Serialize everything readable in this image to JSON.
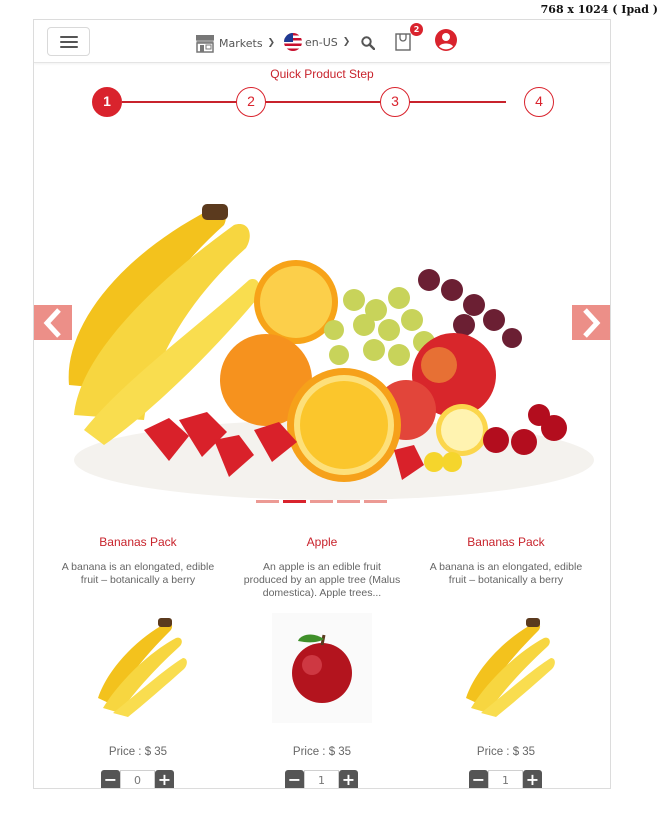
{
  "device_label": "768 x 1024 ( Ipad )",
  "header": {
    "markets_label": "Markets",
    "language_label": "en-US",
    "cart_count": "2",
    "icons": [
      "menu-icon",
      "store-icon",
      "us-flag-icon",
      "chevron-down-icon",
      "search-icon",
      "shopping-bag-icon",
      "user-circle-icon"
    ]
  },
  "steps": {
    "title": "Quick Product Step",
    "items": [
      "1",
      "2",
      "3",
      "4"
    ],
    "active_index": 0
  },
  "carousel": {
    "slide_count": 5,
    "active_slide": 1,
    "icons": [
      "chevron-left-icon",
      "chevron-right-icon"
    ]
  },
  "products": [
    {
      "name": "Bananas Pack",
      "description": "A banana is an elongated, edible fruit – botanically a berry",
      "price": "Price : $ 35",
      "qty": "0",
      "image": "banana-image"
    },
    {
      "name": "Apple",
      "description": "An apple is an edible fruit produced by an apple tree (Malus domestica). Apple trees...",
      "price": "Price : $ 35",
      "qty": "1",
      "image": "apple-image"
    },
    {
      "name": "Bananas Pack",
      "description": "A banana is an elongated, edible fruit – botanically a berry",
      "price": "Price : $ 35",
      "qty": "1",
      "image": "banana-image"
    }
  ],
  "colors": {
    "accent": "#d9232d",
    "arrow": "#ec8f88",
    "text_muted": "#666666"
  }
}
